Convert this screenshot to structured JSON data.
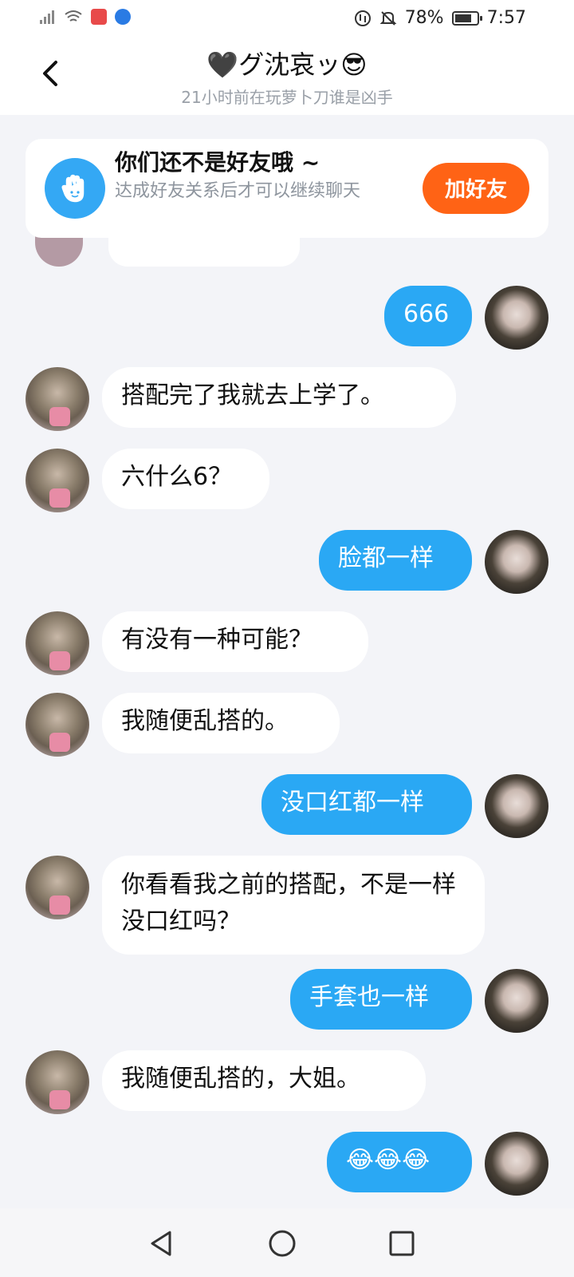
{
  "status_bar": {
    "battery_percent": "78%",
    "battery_level": 0.78,
    "time": "7:57"
  },
  "header": {
    "title": "🖤グ沈哀ッ😎",
    "subtitle": "21小时前在玩萝卜刀谁是凶手"
  },
  "friend_banner": {
    "title": "你们还不是好友哦 ~",
    "description": "达成好友关系后才可以继续聊天",
    "button_label": "加好友",
    "button_color": "#ff6315"
  },
  "messages": [
    {
      "sender": "self",
      "text": "666"
    },
    {
      "sender": "other",
      "text": "搭配完了我就去上学了。"
    },
    {
      "sender": "other",
      "text": "六什么6？"
    },
    {
      "sender": "self",
      "text": "脸都一样"
    },
    {
      "sender": "other",
      "text": "有没有一种可能？"
    },
    {
      "sender": "other",
      "text": "我随便乱搭的。"
    },
    {
      "sender": "self",
      "text": "没口红都一样"
    },
    {
      "sender": "other",
      "text": "你看看我之前的搭配，不是一样没口红吗？"
    },
    {
      "sender": "self",
      "text": "手套也一样"
    },
    {
      "sender": "other",
      "text": "我随便乱搭的，大姐。"
    },
    {
      "sender": "self",
      "text": "😂😂😂"
    }
  ],
  "colors": {
    "self_bubble": "#2aa8f4",
    "other_bubble": "#ffffff",
    "chat_background": "#f3f4f8"
  },
  "icons": {
    "back": "chevron-left-icon",
    "banner": "hand-wave-icon",
    "nav_back": "triangle-back-icon",
    "nav_home": "circle-home-icon",
    "nav_recents": "square-recents-icon"
  }
}
